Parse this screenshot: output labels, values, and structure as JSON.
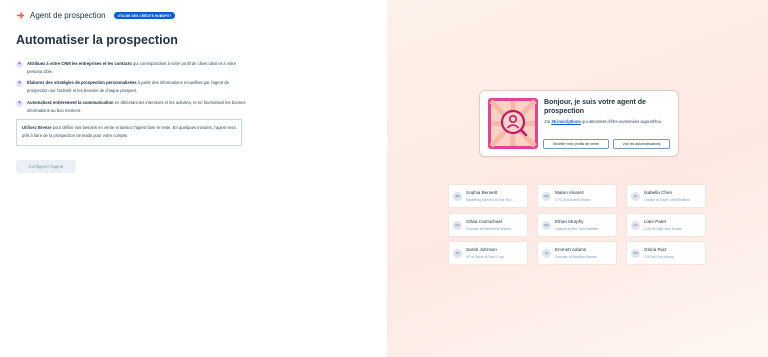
{
  "header": {
    "title": "Agent de prospection",
    "badge": "UTILISE DES CRÉDITS HUBSPOT"
  },
  "main": {
    "title": "Automatiser la prospection",
    "features": [
      {
        "bold": "Attribuez à votre CRM les entreprises et les contacts",
        "text": " qui correspondent à votre profil de client idéal et à votre persona cible."
      },
      {
        "bold": "Élaborez des stratégies de prospection personnalisées",
        "text": " à partir des informations recueillies par l'agent de prospection sur l'activité et les besoins de chaque prospect."
      },
      {
        "bold": "Automatisez entièrement la communication",
        "text": " en détectant les intentions et les activités, et en fournissant les bonnes informations au bon moment."
      }
    ],
    "info_bold": "Utilisez Breeze",
    "info_text": " pour définir vos besoins en vente et laissez l'agent faire le reste. En quelques minutes, l'agent sera prêt à faire de la prospection de leads pour votre compte.",
    "config_button": "Configurer l'agent"
  },
  "agent_card": {
    "title": "Bonjour, je suis votre agent de prospection",
    "text_before": "J'ai ",
    "link": "36 inscriptions",
    "text_after": " qui attendent d'être examinées aujourd'hui.",
    "btn_profiles": "Modifier mes profils de vente",
    "btn_automations": "Voir les automatisations"
  },
  "contacts": [
    {
      "initials": "SB",
      "name": "Sophia Bennett",
      "role": "Marketing Director at Oak Rid..."
    },
    {
      "initials": "MA",
      "name": "Mateo Alvarez",
      "role": "CTO at Succent Cellars"
    },
    {
      "initials": "IC",
      "name": "Isabella Chen",
      "role": "Creator at Silver Leaf Distillers"
    },
    {
      "initials": "OC",
      "name": "Olivia Carmichael",
      "role": "Founder at Riverstone Winery"
    },
    {
      "initials": "EM",
      "name": "Ethan Murphy",
      "role": "Legend at Red Trail Distillers"
    },
    {
      "initials": "LP",
      "name": "Liam Patel",
      "role": "COO at High Vine Estate"
    },
    {
      "initials": "SJ",
      "name": "Sarah Johnson",
      "role": "VP of Sales at Tech Corp"
    },
    {
      "initials": "JA",
      "name": "Emmett Adams",
      "role": "Founder of Brooklyn Meads"
    },
    {
      "initials": "GR",
      "name": "Gloria Ruiz",
      "role": "COO at Sun Winery"
    }
  ],
  "colors": {
    "accent": "#ff5c35",
    "badge": "#0b5bd3",
    "agent_frame": "#e3438f"
  },
  "icons": {
    "logo": "hubspot-sprocket-icon",
    "feature": "sparkle-icon",
    "agent": "magnifier-person-icon"
  }
}
